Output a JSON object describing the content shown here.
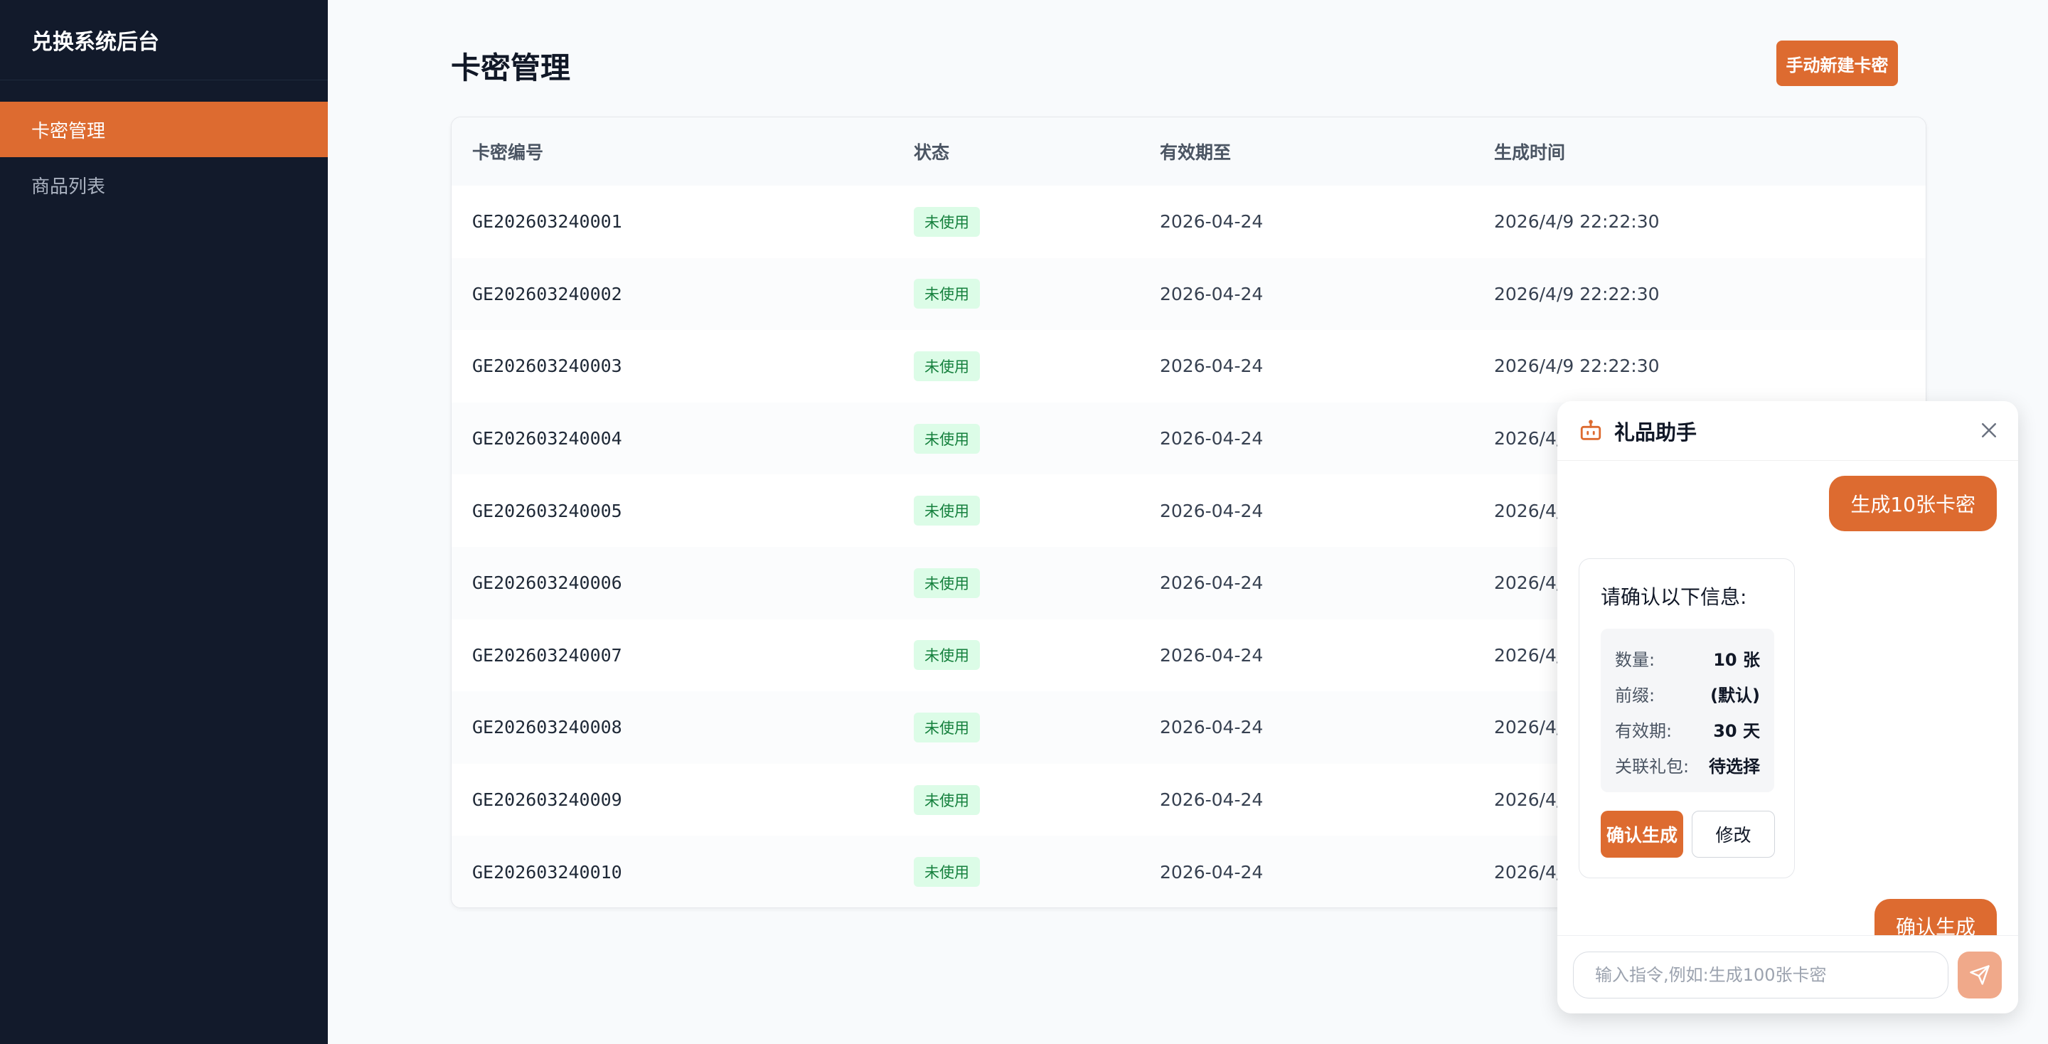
{
  "sidebar": {
    "brand": "兑换系统后台",
    "items": [
      {
        "label": "卡密管理",
        "active": true
      },
      {
        "label": "商品列表",
        "active": false
      }
    ]
  },
  "main": {
    "title": "卡密管理",
    "create_button": "手动新建卡密",
    "table": {
      "headers": [
        "卡密编号",
        "状态",
        "有效期至",
        "生成时间"
      ],
      "rows": [
        {
          "code": "GE202603240001",
          "status": "未使用",
          "expires": "2026-04-24",
          "created": "2026/4/9 22:22:30"
        },
        {
          "code": "GE202603240002",
          "status": "未使用",
          "expires": "2026-04-24",
          "created": "2026/4/9 22:22:30"
        },
        {
          "code": "GE202603240003",
          "status": "未使用",
          "expires": "2026-04-24",
          "created": "2026/4/9 22:22:30"
        },
        {
          "code": "GE202603240004",
          "status": "未使用",
          "expires": "2026-04-24",
          "created": "2026/4/"
        },
        {
          "code": "GE202603240005",
          "status": "未使用",
          "expires": "2026-04-24",
          "created": "2026/4/"
        },
        {
          "code": "GE202603240006",
          "status": "未使用",
          "expires": "2026-04-24",
          "created": "2026/4/"
        },
        {
          "code": "GE202603240007",
          "status": "未使用",
          "expires": "2026-04-24",
          "created": "2026/4/"
        },
        {
          "code": "GE202603240008",
          "status": "未使用",
          "expires": "2026-04-24",
          "created": "2026/4/"
        },
        {
          "code": "GE202603240009",
          "status": "未使用",
          "expires": "2026-04-24",
          "created": "2026/4/"
        },
        {
          "code": "GE202603240010",
          "status": "未使用",
          "expires": "2026-04-24",
          "created": "2026/4/"
        }
      ]
    }
  },
  "chat": {
    "title": "礼品助手",
    "user_message_1": "生成10张卡密",
    "confirm": {
      "heading": "请确认以下信息:",
      "fields": [
        {
          "key": "数量:",
          "value": "10 张"
        },
        {
          "key": "前缀:",
          "value": "(默认)"
        },
        {
          "key": "有效期:",
          "value": "30 天"
        },
        {
          "key": "关联礼包:",
          "value": "待选择"
        }
      ],
      "confirm_button": "确认生成",
      "edit_button": "修改"
    },
    "user_message_2": "确认生成",
    "input": {
      "value": "",
      "placeholder": "输入指令,例如:生成100张卡密"
    }
  },
  "colors": {
    "accent": "#dd6b30",
    "sidebar_bg": "#121a2b",
    "badge_bg": "#dcfce7",
    "badge_text": "#15803d"
  },
  "icons": {
    "chat_header": "robot-icon",
    "chat_close": "close-icon",
    "send": "send-icon"
  }
}
